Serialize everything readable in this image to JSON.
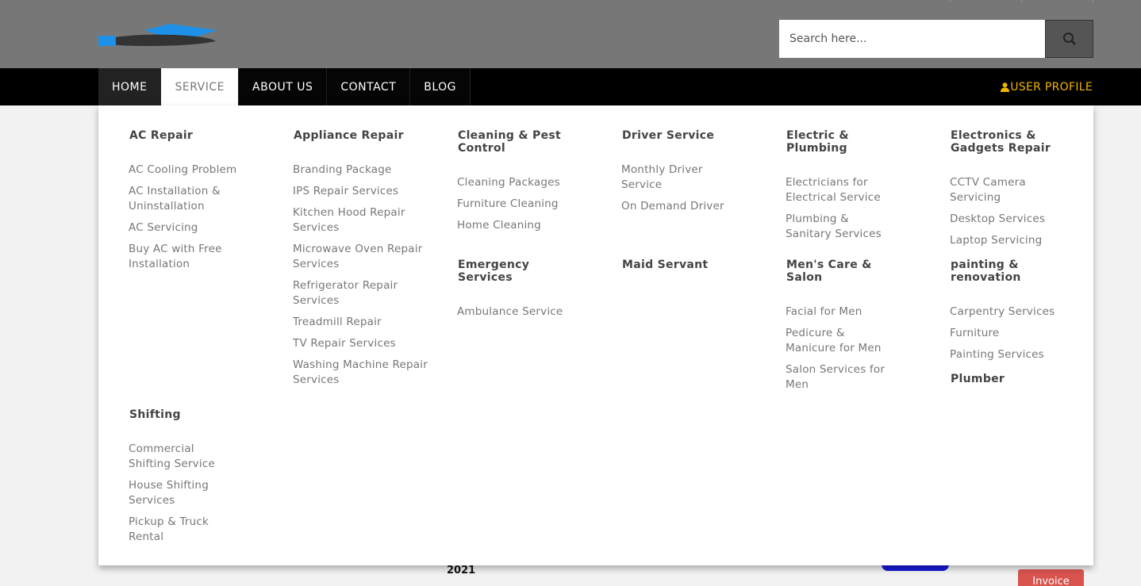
{
  "search": {
    "placeholder": "Search here..."
  },
  "nav": {
    "items": [
      "HOME",
      "SERVICE",
      "ABOUT US",
      "CONTACT",
      "BLOG"
    ],
    "profile": "USER PROFILE"
  },
  "background": {
    "year": "2021",
    "invoice": "Invoice"
  },
  "menu": {
    "col1": {
      "title": "AC Repair",
      "items": [
        "AC Cooling Problem",
        "AC Installation & Uninstallation",
        "AC Servicing",
        "Buy AC with Free Installation"
      ]
    },
    "col2": {
      "title": "Appliance Repair",
      "items": [
        "Branding Package",
        "IPS Repair Services",
        "Kitchen Hood Repair Services",
        "Microwave Oven Repair Services",
        "Refrigerator Repair Services",
        "Treadmill Repair",
        "TV Repair Services",
        "Washing Machine Repair Services"
      ]
    },
    "col3": {
      "title": "Cleaning & Pest Control",
      "items": [
        "Cleaning Packages",
        "Furniture Cleaning",
        "Home Cleaning"
      ]
    },
    "col3b": {
      "title": "Emergency Services",
      "items": [
        "Ambulance Service"
      ]
    },
    "col4": {
      "title": "Driver Service",
      "items": [
        "Monthly Driver Service",
        "On Demand Driver"
      ]
    },
    "col4b": {
      "title": "Maid Servant",
      "items": []
    },
    "col5": {
      "title": "Electric & Plumbing",
      "items": [
        "Electricians for Electrical Service",
        "Plumbing & Sanitary Services"
      ]
    },
    "col5b": {
      "title": "Men's Care & Salon",
      "items": [
        "Facial for Men",
        "Pedicure & Manicure for Men",
        "Salon Services for Men"
      ]
    },
    "col6": {
      "title": "Electronics & Gadgets Repair",
      "items": [
        "CCTV Camera Servicing",
        "Desktop Services",
        "Laptop Servicing"
      ]
    },
    "col6b": {
      "title": "painting & renovation",
      "items": [
        "Carpentry Services",
        "Furniture",
        "Painting Services"
      ]
    },
    "col6c": {
      "title": "Plumber",
      "items": []
    },
    "col7": {
      "title": "Shifting",
      "items": [
        "Commercial Shifting Service",
        "House Shifting Services",
        "Pickup & Truck Rental"
      ]
    }
  },
  "colors": {
    "nav_bg": "#000000",
    "profile": "#f0b400",
    "logo_blue": "#1e90e8",
    "invoice": "#d9534f"
  },
  "icons": [
    "logo-icon",
    "search-icon",
    "user-icon"
  ]
}
